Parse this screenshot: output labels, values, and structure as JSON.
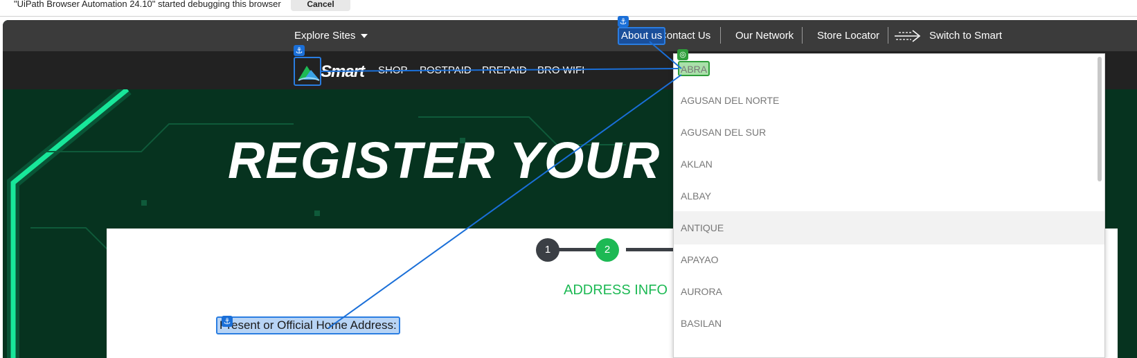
{
  "infobar": {
    "message": "\"UiPath Browser Automation 24.10\" started debugging this browser",
    "cancel_label": "Cancel"
  },
  "topbar": {
    "explore": "Explore Sites",
    "about": "About us",
    "contact": "Contact Us",
    "network": "Our Network",
    "store": "Store Locator",
    "switch": "Switch to Smart"
  },
  "nav": {
    "logo": "Smart",
    "shop": "SHOP",
    "postpaid": "POSTPAID",
    "prepaid": "PREPAID",
    "bro": "BRO WIFI"
  },
  "hero": {
    "title": "REGISTER YOUR SI"
  },
  "form": {
    "step1": "1",
    "step2": "2",
    "section_title": "ADDRESS INFO",
    "address_label": "Present or Official Home Address:"
  },
  "dropdown": {
    "items": [
      "ABRA",
      "AGUSAN DEL NORTE",
      "AGUSAN DEL SUR",
      "AKLAN",
      "ALBAY",
      "ANTIQUE",
      "APAYAO",
      "AURORA",
      "BASILAN"
    ]
  },
  "colors": {
    "accent_green": "#1db954",
    "uipath_blue": "#1a6fd8",
    "nav_dark": "#222222"
  }
}
